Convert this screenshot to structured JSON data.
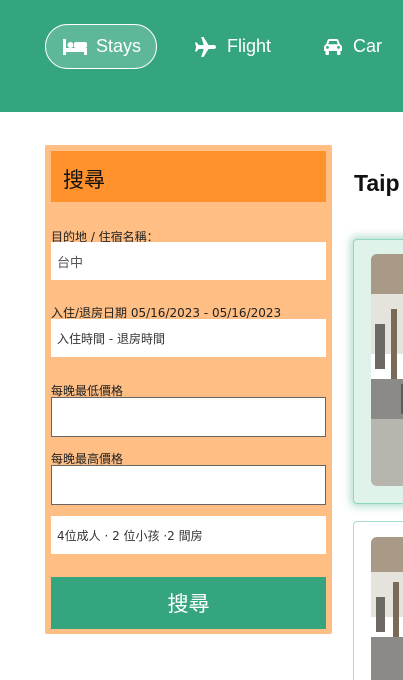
{
  "nav": {
    "stays": {
      "label": "Stays",
      "icon": "bed-icon"
    },
    "flight": {
      "label": "Flight",
      "icon": "airplane-icon"
    },
    "car": {
      "label": "Car",
      "icon": "car-icon"
    }
  },
  "search": {
    "title": "搜尋",
    "destination_label": "目的地 / 住宿名稱：",
    "destination_value": "台中",
    "dates_label": "入住/退房日期 05/16/2023 - 05/16/2023",
    "dates_value": "入住時間 - 退房時間",
    "min_price_label": "每晚最低價格",
    "min_price_value": "",
    "max_price_label": "每晚最高價格",
    "max_price_value": "",
    "guests_value": "4位成人 · 2 位小孩 ·2 間房",
    "submit_label": "搜尋"
  },
  "results": {
    "heading": "Taip"
  },
  "colors": {
    "brand_green": "#35a57f",
    "panel_orange": "#febe84",
    "title_orange": "#ff922d"
  }
}
